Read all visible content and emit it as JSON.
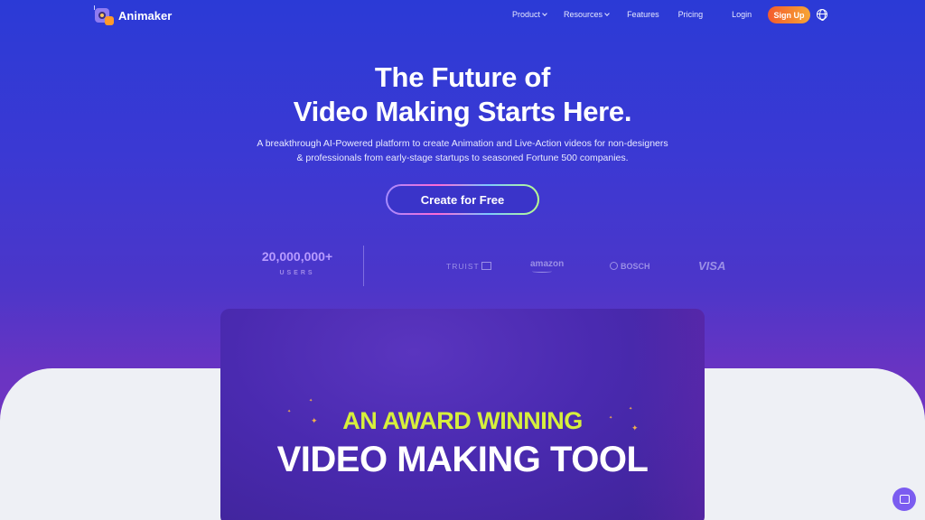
{
  "nav": {
    "brand": "Animaker",
    "items": [
      {
        "label": "Product",
        "has_dropdown": true
      },
      {
        "label": "Resources",
        "has_dropdown": true
      },
      {
        "label": "Features",
        "has_dropdown": false
      },
      {
        "label": "Pricing",
        "has_dropdown": false
      }
    ],
    "login": "Login",
    "signup": "Sign Up",
    "language_icon": "globe-icon"
  },
  "hero": {
    "title_line1": "The Future of",
    "title_line2": "Video Making Starts Here.",
    "subtitle_line1": "A breakthrough AI-Powered platform to create Animation and Live-Action videos for non-designers",
    "subtitle_line2": "& professionals from early-stage startups to seasoned Fortune 500 companies.",
    "cta": "Create for Free"
  },
  "stats": {
    "count": "20,000,000+",
    "label": "USERS"
  },
  "brands": [
    "TRUIST",
    "amazon",
    "BOSCH",
    "VISA"
  ],
  "video": {
    "line1": "AN AWARD WINNING",
    "line2": "VIDEO MAKING TOOL"
  },
  "colors": {
    "accent_lime": "#d7ef3c",
    "signup_orange": "#f45b2d",
    "chat_purple": "#7b5cf0"
  }
}
